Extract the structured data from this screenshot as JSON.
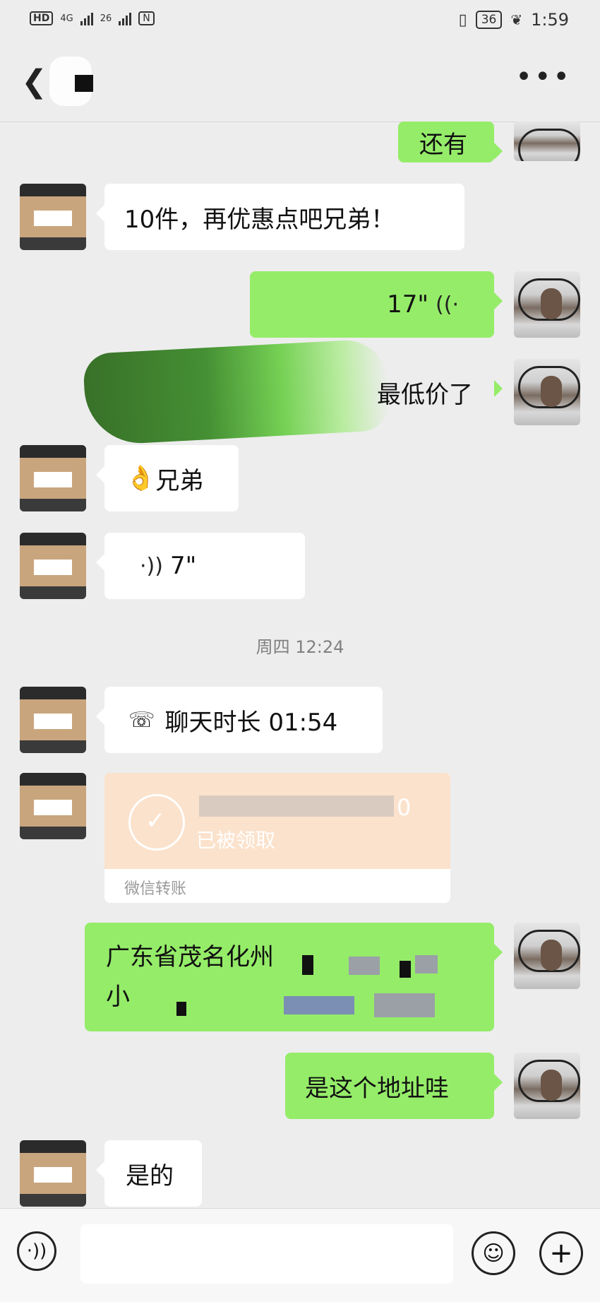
{
  "status_bar": {
    "left_icons": [
      "HD",
      "4G",
      "26"
    ],
    "battery": "36",
    "time": "1:59"
  },
  "header": {
    "back_icon": "chevron-left-icon",
    "more_icon": "more-dots-icon"
  },
  "messages": [
    {
      "side": "self",
      "type": "text",
      "text": "还有"
    },
    {
      "side": "other",
      "type": "text",
      "text": "10件，再优惠点吧兄弟！"
    },
    {
      "side": "self",
      "type": "voice",
      "duration": "17\""
    },
    {
      "side": "self",
      "type": "text",
      "text": "最低价了"
    },
    {
      "side": "other",
      "type": "text",
      "emoji": "👌",
      "text": "兄弟"
    },
    {
      "side": "other",
      "type": "voice",
      "duration": "7\""
    },
    {
      "type": "time",
      "text": "周四 12:24"
    },
    {
      "side": "other",
      "type": "call",
      "text": "聊天时长 01:54"
    },
    {
      "side": "other",
      "type": "transfer",
      "amount_suffix": "0",
      "status": "已被领取",
      "footer": "微信转账"
    },
    {
      "side": "self",
      "type": "text",
      "line1": "广东省茂名化州",
      "line2": "小"
    },
    {
      "side": "self",
      "type": "text",
      "text": "是这个地址哇"
    },
    {
      "side": "other",
      "type": "text",
      "text": "是的"
    }
  ],
  "input_bar": {
    "voice_icon": "voice-icon",
    "emoji_icon": "emoji-icon",
    "plus_icon": "plus-icon"
  }
}
